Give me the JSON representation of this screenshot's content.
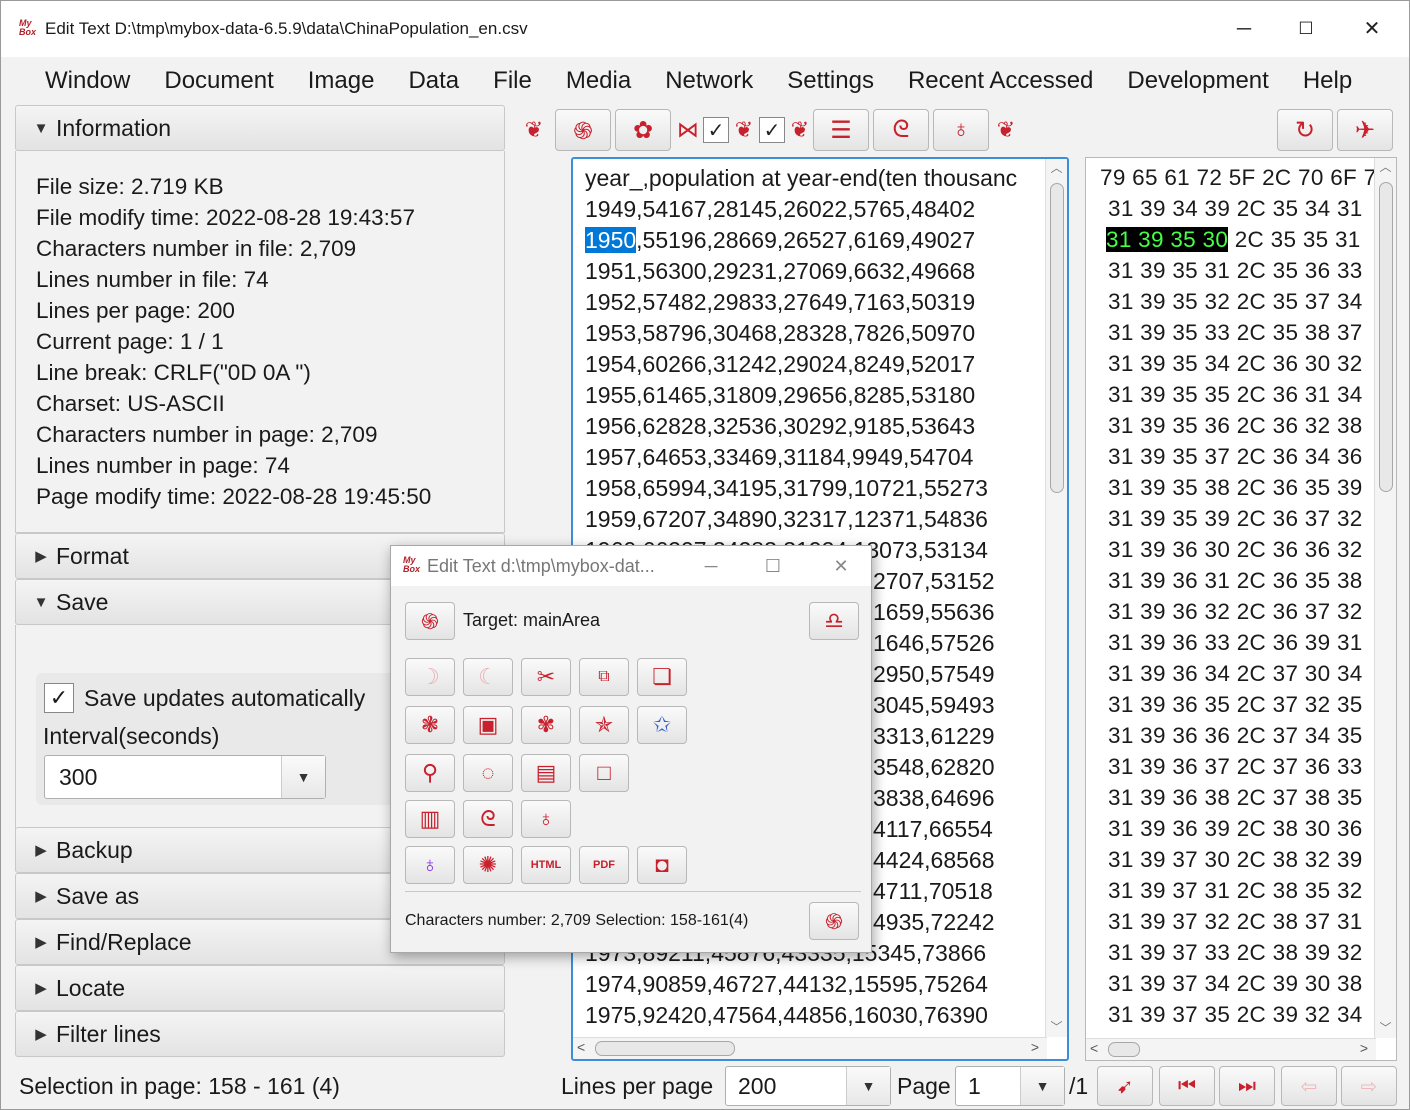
{
  "app": {
    "title": "Edit Text  D:\\tmp\\mybox-data-6.5.9\\data\\ChinaPopulation_en.csv",
    "logo_text": "My Box",
    "window_controls": [
      "─",
      "☐",
      "✕"
    ]
  },
  "menu": [
    "Window",
    "Document",
    "Image",
    "Data",
    "File",
    "Media",
    "Network",
    "Settings",
    "Recent Accessed",
    "Development",
    "Help"
  ],
  "left_panel": {
    "information": {
      "title": "Information",
      "lines": [
        "File size: 2.719 KB",
        "File modify time: 2022-08-28 19:43:57",
        "Characters number in file: 2,709",
        "Lines number in file: 74",
        "Lines per page: 200",
        "Current page: 1 / 1",
        "Line break: CRLF(\"0D 0A \")",
        "Charset: US-ASCII",
        "Characters number in page: 2,709",
        "Lines number in page: 74",
        "Page modify time: 2022-08-28 19:45:50"
      ]
    },
    "format_title": "Format",
    "save": {
      "title": "Save",
      "auto_label": "Save updates automatically",
      "auto_checked": true,
      "interval_label": "Interval(seconds)",
      "interval_value": "300"
    },
    "backup_title": "Backup",
    "save_as_title": "Save as",
    "find_replace_title": "Find/Replace",
    "locate_title": "Locate",
    "filter_title": "Filter lines"
  },
  "editor": {
    "first_line": "year_,population at year-end(ten thousanc",
    "selected_prefix": "1950",
    "lines": [
      "1949,54167,28145,26022,5765,48402",
      ",55196,28669,26527,6169,49027",
      "1951,56300,29231,27069,6632,49668",
      "1952,57482,29833,27649,7163,50319",
      "1953,58796,30468,28328,7826,50970",
      "1954,60266,31242,29024,8249,52017",
      "1955,61465,31809,29656,8285,53180",
      "1956,62828,32536,30292,9185,53643",
      "1957,64653,33469,31184,9949,54704",
      "1958,65994,34195,31799,10721,55273",
      "1959,67207,34890,32317,12371,54836",
      "1960,66207,34283,31924,13073,53134",
      "2707,53152",
      "1659,55636",
      "1646,57526",
      "2950,57549",
      "3045,59493",
      "3313,61229",
      "3548,62820",
      "3838,64696",
      "4117,66554",
      "4424,68568",
      "4711,70518",
      "4935,72242",
      "1973,89211,45876,43335,15345,73866",
      "1974,90859,46727,44132,15595,75264",
      "1975,92420,47564,44856,16030,76390"
    ]
  },
  "hex": {
    "first_line": "79 65 61 72 5F 2C 70 6F 7",
    "selected": "31 39 35 30",
    "lines": [
      "31 39 34 39 2C 35 34 31",
      " 2C 35 35 31",
      "31 39 35 31 2C 35 36 33",
      "31 39 35 32 2C 35 37 34",
      "31 39 35 33 2C 35 38 37",
      "31 39 35 34 2C 36 30 32",
      "31 39 35 35 2C 36 31 34",
      "31 39 35 36 2C 36 32 38",
      "31 39 35 37 2C 36 34 36",
      "31 39 35 38 2C 36 35 39",
      "31 39 35 39 2C 36 37 32",
      "31 39 36 30 2C 36 36 32",
      "31 39 36 31 2C 36 35 38",
      "31 39 36 32 2C 36 37 32",
      "31 39 36 33 2C 36 39 31",
      "31 39 36 34 2C 37 30 34",
      "31 39 36 35 2C 37 32 35",
      "31 39 36 36 2C 37 34 35",
      "31 39 36 37 2C 37 36 33",
      "31 39 36 38 2C 37 38 35",
      "31 39 36 39 2C 38 30 36",
      "31 39 37 30 2C 38 32 39",
      "31 39 37 31 2C 38 35 32",
      "31 39 37 32 2C 38 37 31",
      "31 39 37 33 2C 38 39 32",
      "31 39 37 34 2C 39 30 38",
      "31 39 37 35 2C 39 32 34"
    ]
  },
  "status": {
    "selection": "Selection in page: 158 - 161 (4)",
    "lines_per_page_label": "Lines per page",
    "lines_per_page_value": "200",
    "page_label": "Page",
    "page_value": "1",
    "page_total": "/1"
  },
  "popup": {
    "title": "Edit Text  d:\\tmp\\mybox-dat...",
    "target": "Target: mainArea",
    "footer": "Characters number: 2,709  Selection: 158-161(4)",
    "html_label": "HTML",
    "pdf_label": "PDF"
  },
  "colors": {
    "accent_red": "#c8202c",
    "selection_blue": "#0078d7",
    "hex_highlight_fg": "#46ff46",
    "focus_border": "#3b8fd9"
  }
}
